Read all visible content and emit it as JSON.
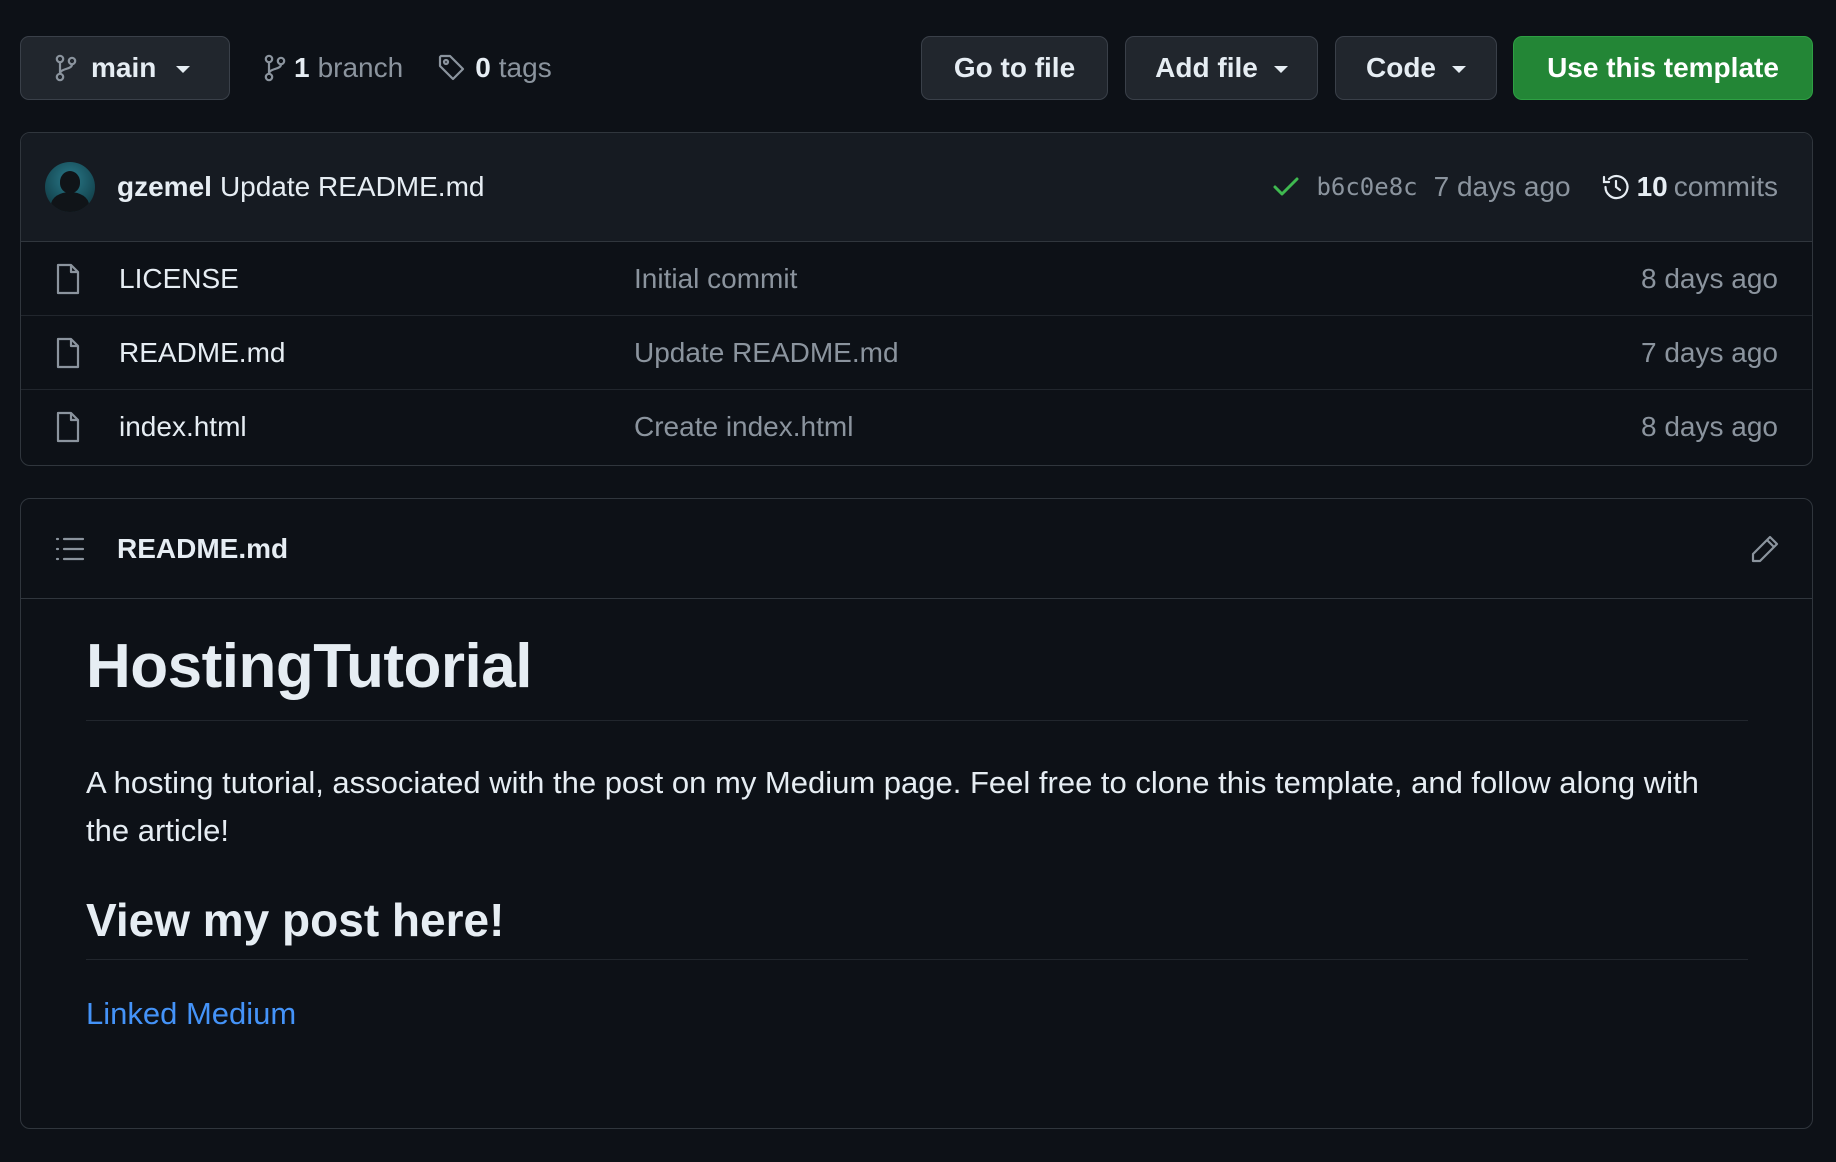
{
  "toolbar": {
    "branch_name": "main",
    "branch_count": "1",
    "branch_label": "branch",
    "tag_count": "0",
    "tag_label": "tags",
    "goto_file": "Go to file",
    "add_file": "Add file",
    "code": "Code",
    "use_template": "Use this template"
  },
  "latest_commit": {
    "author": "gzemel",
    "message": "Update README.md",
    "sha": "b6c0e8c",
    "time": "7 days ago",
    "commit_count": "10",
    "commits_label": "commits"
  },
  "files": [
    {
      "name": "LICENSE",
      "commit": "Initial commit",
      "age": "8 days ago"
    },
    {
      "name": "README.md",
      "commit": "Update README.md",
      "age": "7 days ago"
    },
    {
      "name": "index.html",
      "commit": "Create index.html",
      "age": "8 days ago"
    }
  ],
  "readme": {
    "file_title": "README.md",
    "heading": "HostingTutorial",
    "description": "A hosting tutorial, associated with the post on my Medium page. Feel free to clone this template, and follow along with the article!",
    "subheading": "View my post here!",
    "link_text": "Linked Medium"
  },
  "colors": {
    "background": "#0d1117",
    "accent_green": "#238636",
    "link_blue": "#4493f8",
    "muted_text": "#8b949e",
    "check_green": "#3fb950"
  }
}
